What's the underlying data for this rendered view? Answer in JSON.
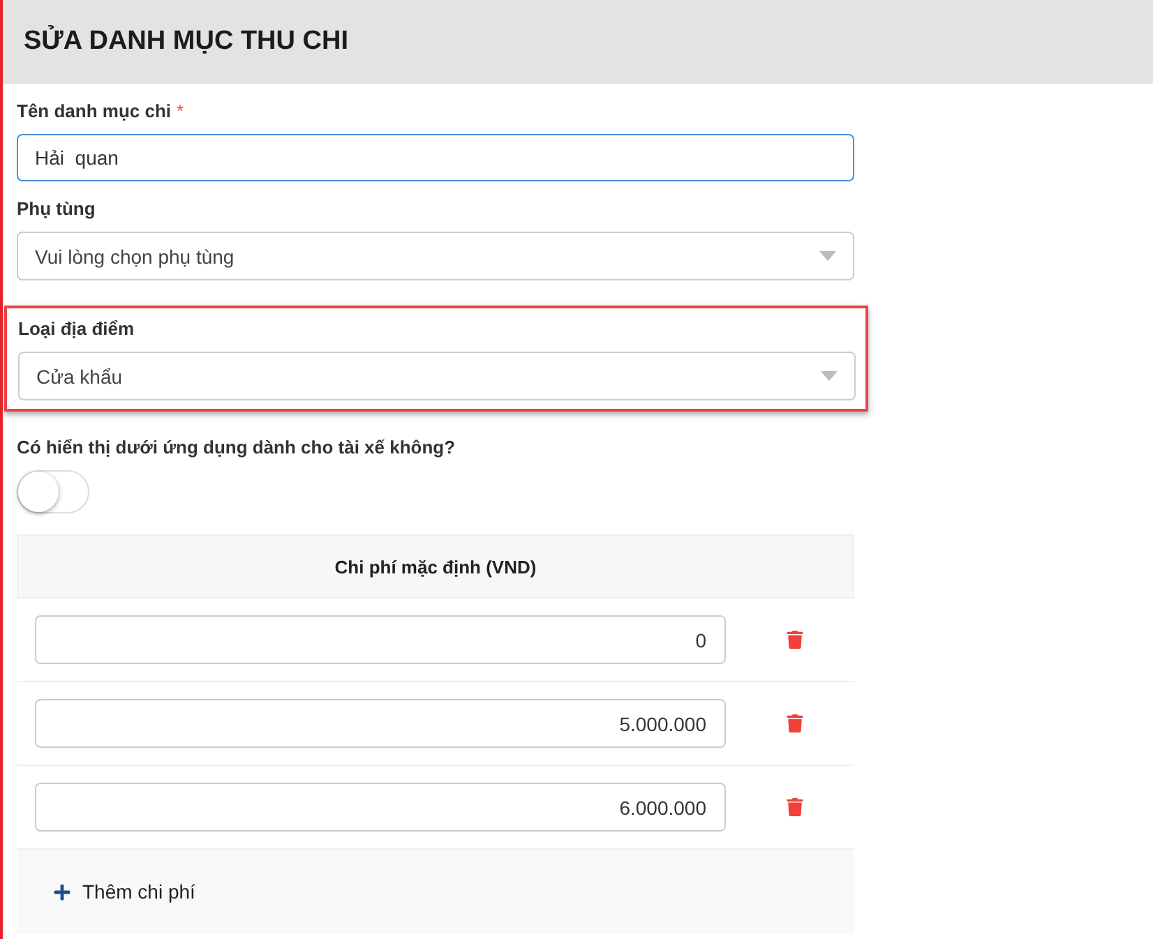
{
  "title": "SỬA DANH MỤC THU CHI",
  "fields": [
    {
      "kind": "text",
      "label": "Tên danh mục chi",
      "required_mark": "*",
      "value": "Hải  quan",
      "focused": true,
      "highlighted": false
    },
    {
      "kind": "select",
      "label": "Phụ tùng",
      "placeholder": "Vui lòng chọn phụ tùng",
      "focused": false,
      "highlighted": false
    },
    {
      "kind": "select",
      "label": "Loại địa điểm",
      "value": "Cửa khẩu",
      "focused": false,
      "highlighted": true
    }
  ],
  "driver_toggle": {
    "label": "Có hiển thị dưới ứng dụng dành cho tài xế không?",
    "on": false
  },
  "costs": {
    "header": "Chi phí mặc định (VND)",
    "rows": [
      {
        "value": "0"
      },
      {
        "value": "5.000.000"
      },
      {
        "value": "6.000.000"
      }
    ],
    "add_label": "Thêm chi phí"
  }
}
